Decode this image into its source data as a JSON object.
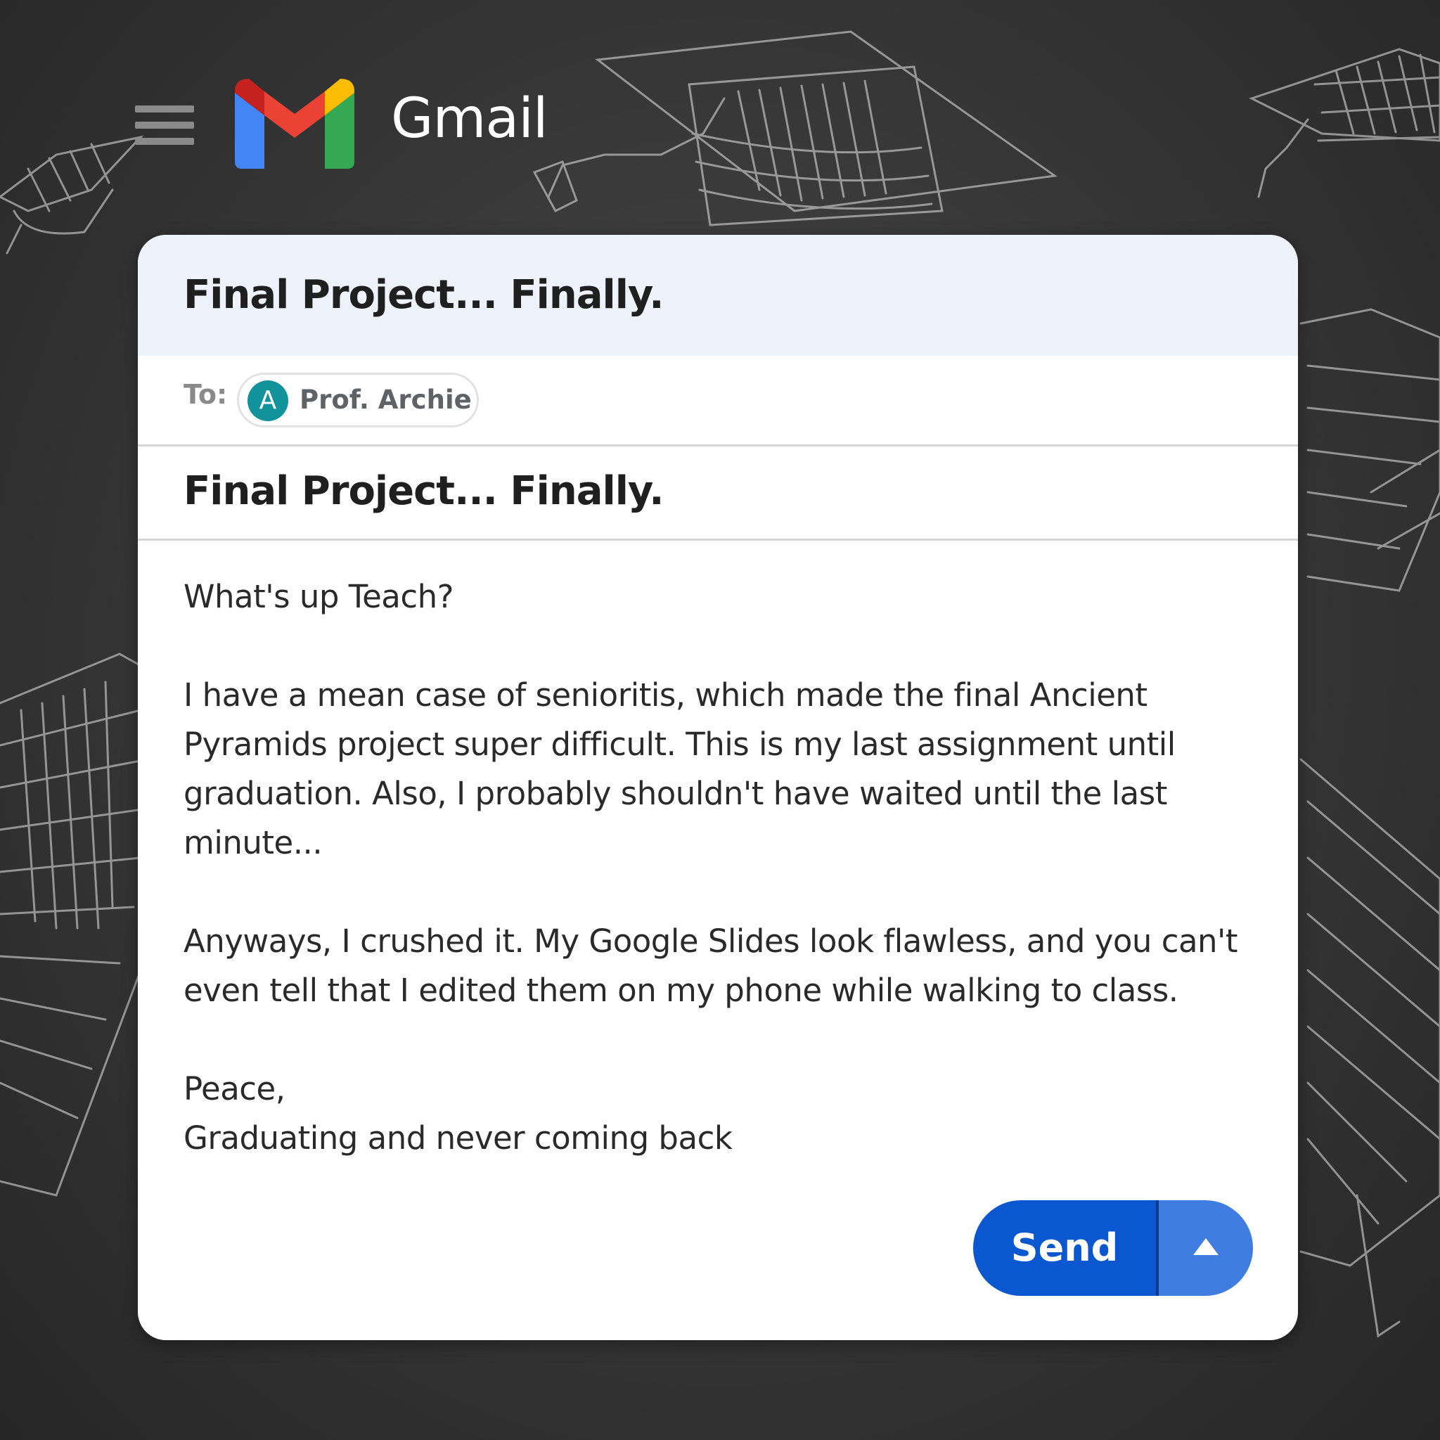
{
  "app": {
    "title": "Gmail",
    "menu_icon": "hamburger-menu-icon",
    "logo_icon": "gmail-logo-icon"
  },
  "compose": {
    "header_title": "Final Project... Finally.",
    "to_label": "To:",
    "recipient": {
      "initial": "A",
      "name": "Prof. Archie",
      "avatar_color": "#12939c"
    },
    "subject": "Final Project... Finally.",
    "body": {
      "greeting": "What's up Teach?",
      "paragraph1": "I have a mean case of senioritis, which made the final Ancient Pyramids project super difficult. This is my last assignment until graduation. Also, I probably shouldn't have waited until the last minute...",
      "paragraph2": "Anyways, I crushed it. My Google Slides look flawless, and you can't even tell that I edited them on my phone while walking to class.",
      "signoff": "Peace,",
      "signature": "Graduating and never coming back"
    },
    "send_label": "Send",
    "send_options_icon": "caret-up-icon"
  },
  "colors": {
    "accent": "#0b57d0",
    "header_bg": "#eef2fa",
    "background": "#3a3a3a"
  }
}
